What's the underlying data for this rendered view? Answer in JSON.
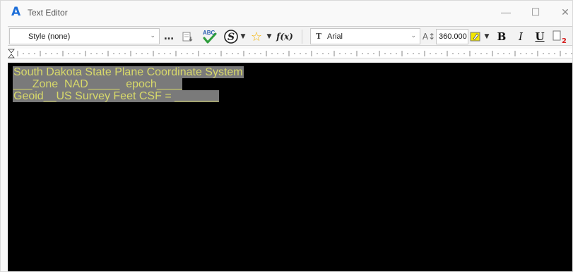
{
  "window": {
    "title": "Text Editor",
    "controls": {
      "minimize": "—",
      "maximize": "☐",
      "close": "✕"
    }
  },
  "toolbar": {
    "style_select": {
      "value": "Style (none)",
      "icon": "chevron-down-icon"
    },
    "more_label": "…",
    "icons": [
      "paste-format-icon",
      "spell-check-icon",
      "symbol-icon",
      "chevron-down-icon",
      "favorite-star-icon",
      "chevron-down-icon",
      "function-icon"
    ],
    "font_select": {
      "value": "Arial",
      "glyph": "T"
    },
    "font_size": "360.000",
    "bold_label": "B",
    "italic_label": "I",
    "underline_label": "U",
    "accent_colors": {
      "star": "#f5b400",
      "spell_check": "#2e9d3c",
      "subscript": "#d62020",
      "text_highlight": "#f2e600"
    }
  },
  "editor": {
    "text_color": "#d8d96a",
    "selection_bg": "#7a7a7a",
    "background": "#000000",
    "lines": [
      "South Dakota State Plane Coordinate System",
      "___Zone  NAD_____  epoch____",
      "Geoid__US Survey Feet CSF = _______"
    ]
  }
}
